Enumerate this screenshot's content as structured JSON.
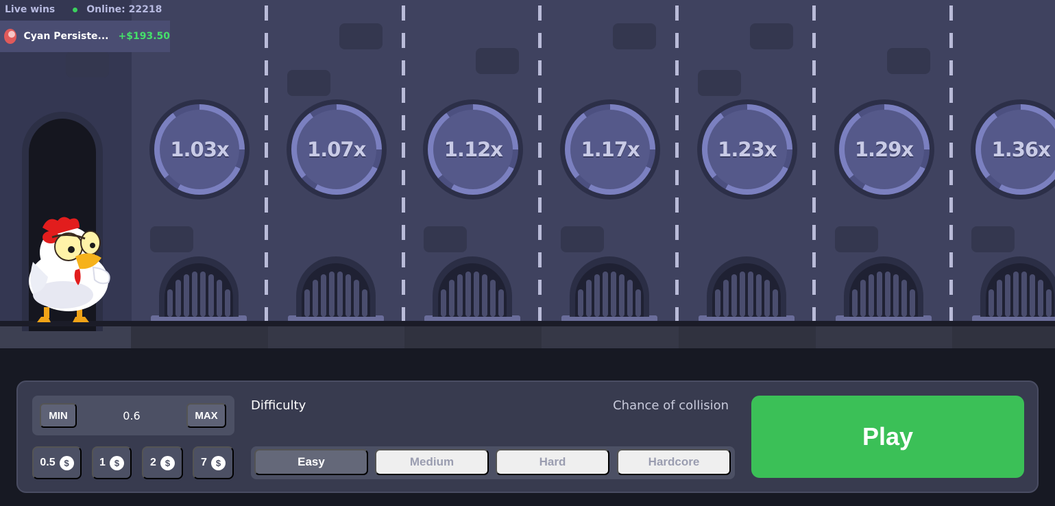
{
  "live": {
    "label": "Live wins",
    "online_text": "Online: 22218",
    "latest_win": {
      "player": "Cyan Persiste...",
      "amount": "+$193.50"
    }
  },
  "lanes": [
    {
      "multiplier": "1.03x"
    },
    {
      "multiplier": "1.07x"
    },
    {
      "multiplier": "1.12x"
    },
    {
      "multiplier": "1.17x"
    },
    {
      "multiplier": "1.23x"
    },
    {
      "multiplier": "1.29x"
    },
    {
      "multiplier": "1.36x"
    }
  ],
  "bet": {
    "min_label": "MIN",
    "max_label": "MAX",
    "value": "0.6",
    "quick_amounts": [
      "0.5",
      "1",
      "2",
      "7"
    ],
    "currency_symbol": "$"
  },
  "difficulty": {
    "label": "Difficulty",
    "chance_label": "Chance of collision",
    "options": [
      "Easy",
      "Medium",
      "Hard",
      "Hardcore"
    ],
    "selected": "Easy"
  },
  "play_label": "Play",
  "colors": {
    "accent_green": "#3bc057",
    "win_green": "#45e06a",
    "lane_bg": "#3f425f"
  },
  "icons": [
    "chicken-character",
    "dollar-coin-icon",
    "online-dot-icon",
    "avatar-icon",
    "sewer-grate-icon"
  ]
}
